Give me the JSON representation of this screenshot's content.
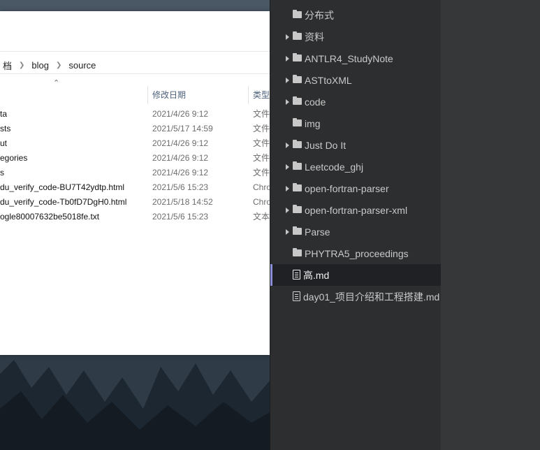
{
  "explorer": {
    "breadcrumb": [
      "档",
      "blog",
      "source"
    ],
    "columns": {
      "date": "修改日期",
      "type": "类型"
    },
    "rows": [
      {
        "name": "ta",
        "date": "2021/4/26 9:12",
        "type": "文件"
      },
      {
        "name": "sts",
        "date": "2021/5/17 14:59",
        "type": "文件"
      },
      {
        "name": "ut",
        "date": "2021/4/26 9:12",
        "type": "文件"
      },
      {
        "name": "egories",
        "date": "2021/4/26 9:12",
        "type": "文件"
      },
      {
        "name": "s",
        "date": "2021/4/26 9:12",
        "type": "文件"
      },
      {
        "name": "du_verify_code-BU7T42ydtp.html",
        "date": "2021/5/6 15:23",
        "type": "Chro"
      },
      {
        "name": "du_verify_code-Tb0fD7DgH0.html",
        "date": "2021/5/18 14:52",
        "type": "Chro"
      },
      {
        "name": "ogle80007632be5018fe.txt",
        "date": "2021/5/6 15:23",
        "type": "文本"
      }
    ]
  },
  "sidebar": {
    "items": [
      {
        "label": "分布式",
        "kind": "folder",
        "expandable": false
      },
      {
        "label": "资料",
        "kind": "folder",
        "expandable": true
      },
      {
        "label": "ANTLR4_StudyNote",
        "kind": "folder",
        "expandable": true
      },
      {
        "label": "ASTtoXML",
        "kind": "folder",
        "expandable": true
      },
      {
        "label": "code",
        "kind": "folder",
        "expandable": true
      },
      {
        "label": "img",
        "kind": "folder",
        "expandable": false
      },
      {
        "label": "Just Do It",
        "kind": "folder",
        "expandable": true
      },
      {
        "label": "Leetcode_ghj",
        "kind": "folder",
        "expandable": true
      },
      {
        "label": "open-fortran-parser",
        "kind": "folder",
        "expandable": true
      },
      {
        "label": "open-fortran-parser-xml",
        "kind": "folder",
        "expandable": true
      },
      {
        "label": "Parse",
        "kind": "folder",
        "expandable": true
      },
      {
        "label": "PHYTRA5_proceedings",
        "kind": "folder",
        "expandable": false
      },
      {
        "label": "高.md",
        "kind": "file",
        "expandable": false,
        "active": true
      },
      {
        "label": "day01_项目介绍和工程搭建.md",
        "kind": "file",
        "expandable": false
      }
    ]
  },
  "colors": {
    "sidebar_bg": "#2d2e30",
    "active_bg": "#202124",
    "active_accent": "#8b8fd9",
    "editor_bg": "#363739"
  }
}
